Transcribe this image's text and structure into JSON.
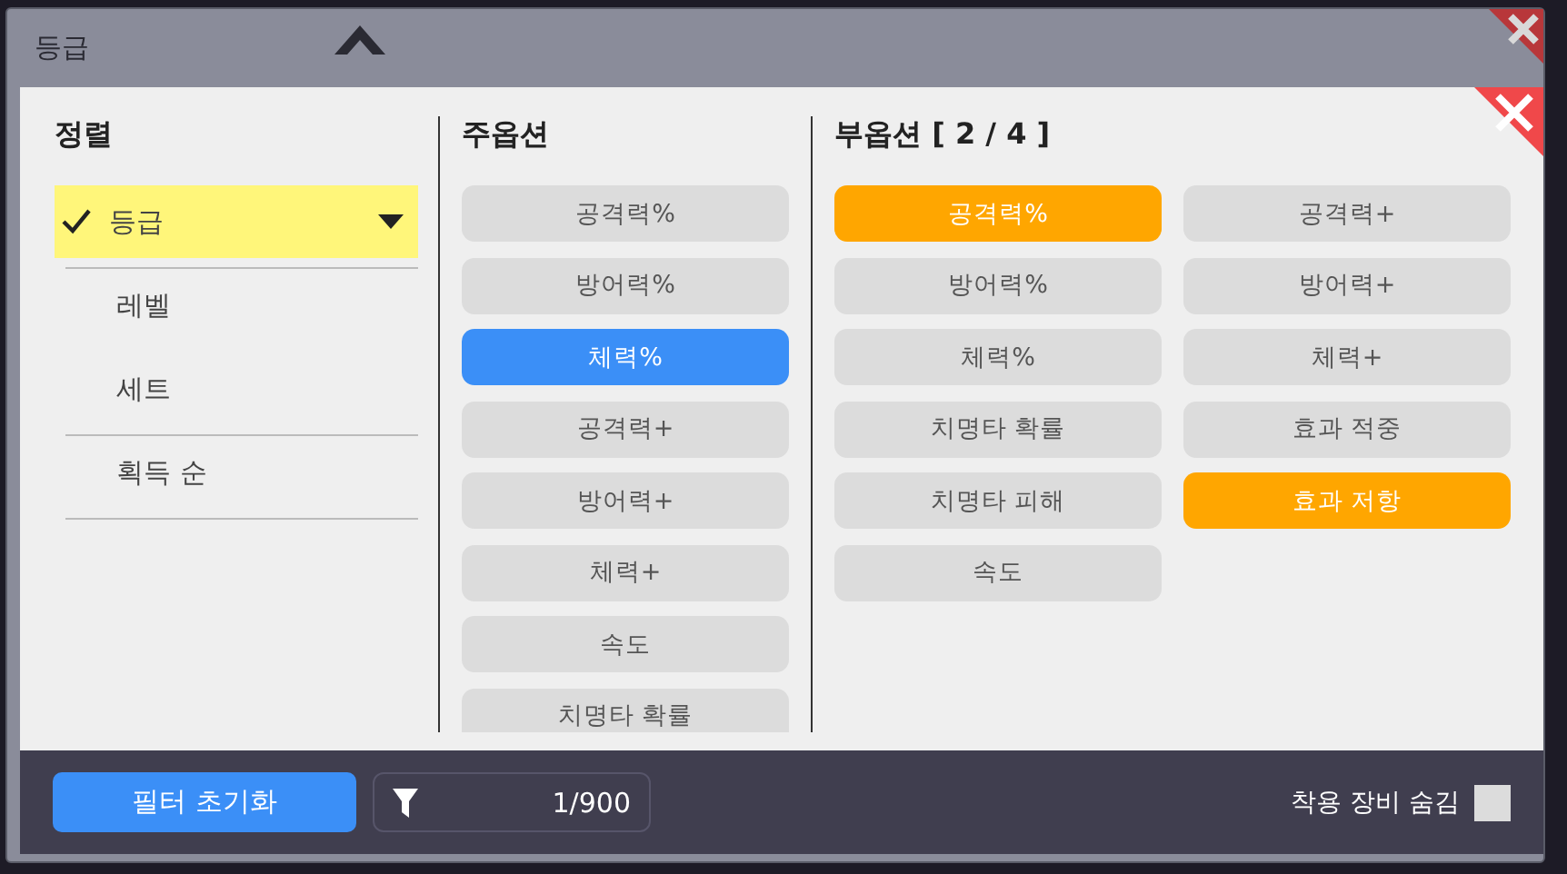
{
  "header": {
    "title": "등급"
  },
  "sort": {
    "title": "정렬",
    "items": [
      {
        "label": "등급",
        "selected": true,
        "separator": true
      },
      {
        "label": "레벨",
        "selected": false,
        "separator": false
      },
      {
        "label": "세트",
        "selected": false,
        "separator": true
      },
      {
        "label": "획득 순",
        "selected": false,
        "separator": true
      }
    ]
  },
  "main_options": {
    "title": "주옵션",
    "options": [
      {
        "label": "공격력%",
        "selected": false
      },
      {
        "label": "방어력%",
        "selected": false
      },
      {
        "label": "체력%",
        "selected": true
      },
      {
        "label": "공격력+",
        "selected": false
      },
      {
        "label": "방어력+",
        "selected": false
      },
      {
        "label": "체력+",
        "selected": false
      },
      {
        "label": "속도",
        "selected": false
      },
      {
        "label": "치명타 확률",
        "selected": false
      }
    ]
  },
  "sub_options": {
    "title": "부옵션 [ 2 / 4 ]",
    "options": [
      {
        "label": "공격력%",
        "selected": true
      },
      {
        "label": "방어력%",
        "selected": false
      },
      {
        "label": "체력%",
        "selected": false
      },
      {
        "label": "치명타 확률",
        "selected": false
      },
      {
        "label": "치명타 피해",
        "selected": false
      },
      {
        "label": "속도",
        "selected": false
      },
      {
        "label": "공격력+",
        "selected": false
      },
      {
        "label": "방어력+",
        "selected": false
      },
      {
        "label": "체력+",
        "selected": false
      },
      {
        "label": "효과 적중",
        "selected": false
      },
      {
        "label": "효과 저항",
        "selected": true
      }
    ]
  },
  "footer": {
    "reset_button": "필터 초기화",
    "count": "1/900",
    "hide_equipped": {
      "label": "착용 장비 숨김",
      "checked": false
    }
  }
}
